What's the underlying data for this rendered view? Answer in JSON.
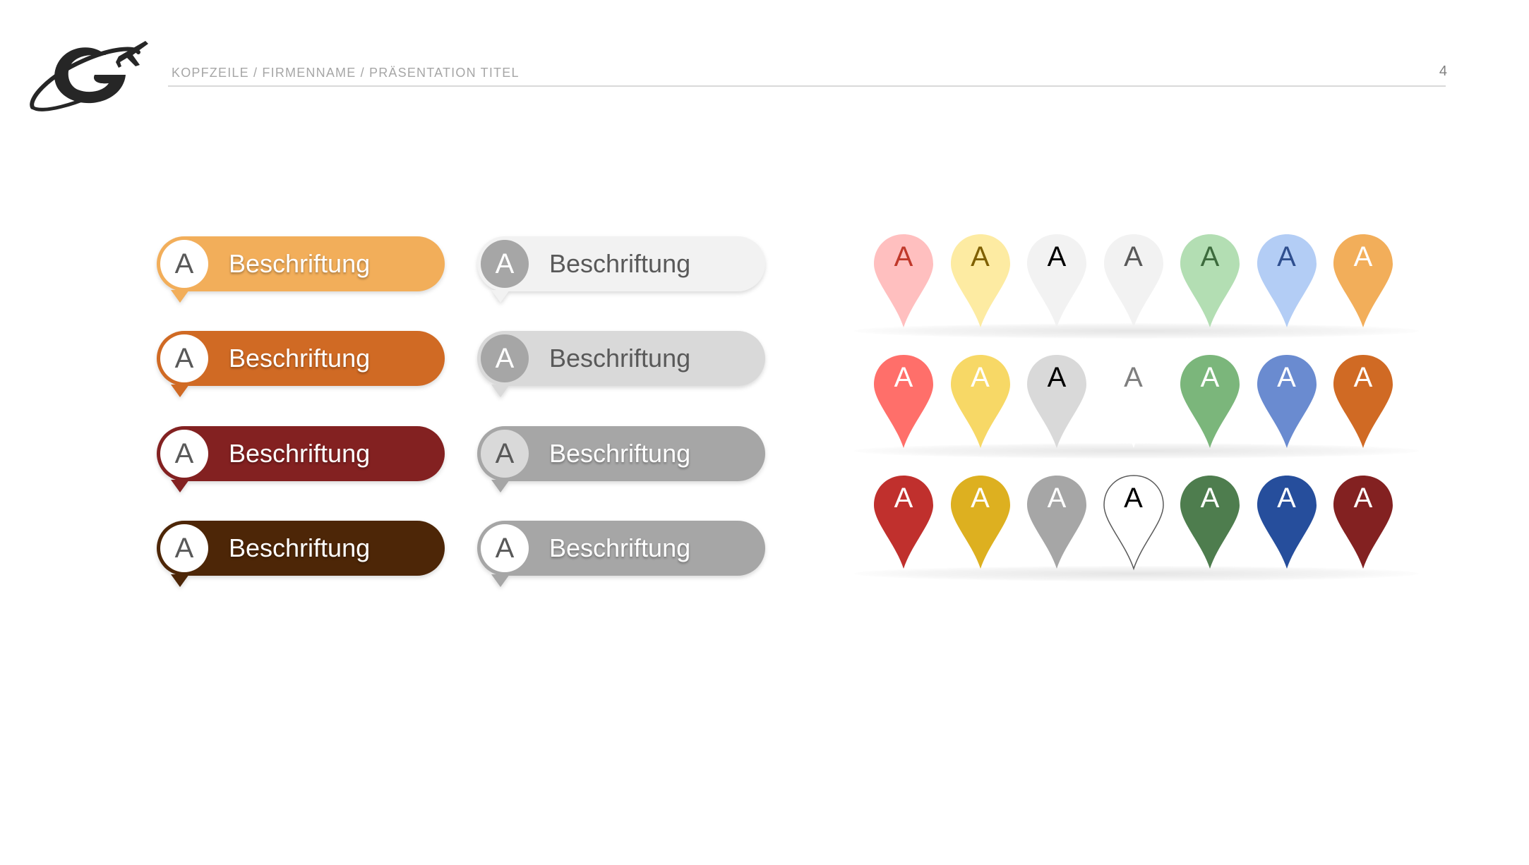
{
  "header": {
    "title": "KOPFZEILE / FIRMENNAME / PRÄSENTATION TITEL",
    "page_number": "4",
    "logo": "airplane-orbit-logo"
  },
  "labels": [
    {
      "letter": "A",
      "text": "Beschriftung",
      "bg": "#f2ae5a",
      "circle_bg": "#ffffff",
      "circle_fg": "#595959",
      "text_color": "#ffffff",
      "style": "light"
    },
    {
      "letter": "A",
      "text": "Beschriftung",
      "bg": "#d06a24",
      "circle_bg": "#ffffff",
      "circle_fg": "#595959",
      "text_color": "#ffffff",
      "style": "light"
    },
    {
      "letter": "A",
      "text": "Beschriftung",
      "bg": "#832121",
      "circle_bg": "#ffffff",
      "circle_fg": "#595959",
      "text_color": "#ffffff",
      "style": "light"
    },
    {
      "letter": "A",
      "text": "Beschriftung",
      "bg": "#4d2607",
      "circle_bg": "#ffffff",
      "circle_fg": "#595959",
      "text_color": "#ffffff",
      "style": "light"
    },
    {
      "letter": "A",
      "text": "Beschriftung",
      "bg": "#f2f2f2",
      "circle_bg": "#a6a6a6",
      "circle_fg": "#ffffff",
      "text_color": "#595959",
      "style": "dark"
    },
    {
      "letter": "A",
      "text": "Beschriftung",
      "bg": "#d9d9d9",
      "circle_bg": "#a6a6a6",
      "circle_fg": "#ffffff",
      "text_color": "#595959",
      "style": "dark"
    },
    {
      "letter": "A",
      "text": "Beschriftung",
      "bg": "#a6a6a6",
      "circle_bg": "#d9d9d9",
      "circle_fg": "#595959",
      "text_color": "#ffffff",
      "style": "light"
    },
    {
      "letter": "A",
      "text": "Beschriftung",
      "bg": "#a6a6a6",
      "circle_bg": "#ffffff",
      "circle_fg": "#595959",
      "text_color": "#ffffff",
      "style": "light"
    }
  ],
  "pins": [
    {
      "letter": "A",
      "fill": "#ffbfbf",
      "text_color": "#c0392b"
    },
    {
      "letter": "A",
      "fill": "#fdeba2",
      "text_color": "#7f6000"
    },
    {
      "letter": "A",
      "fill": "#f2f2f2",
      "text_color": "#000000"
    },
    {
      "letter": "A",
      "fill": "#f2f2f2",
      "text_color": "#595959"
    },
    {
      "letter": "A",
      "fill": "#b3deb3",
      "text_color": "#3d6b3d"
    },
    {
      "letter": "A",
      "fill": "#b3cdf5",
      "text_color": "#2f4f8f"
    },
    {
      "letter": "A",
      "fill": "#f2ae5a",
      "text_color": "#ffffff"
    },
    {
      "letter": "A",
      "fill": "#ff6f6a",
      "text_color": "#ffffff"
    },
    {
      "letter": "A",
      "fill": "#f7d866",
      "text_color": "#ffffff"
    },
    {
      "letter": "A",
      "fill": "#d9d9d9",
      "text_color": "#000000"
    },
    {
      "letter": "A",
      "fill": "#ffffff",
      "text_color": "#7f7f7f"
    },
    {
      "letter": "A",
      "fill": "#7bb67b",
      "text_color": "#ffffff"
    },
    {
      "letter": "A",
      "fill": "#6a8bd0",
      "text_color": "#ffffff"
    },
    {
      "letter": "A",
      "fill": "#d06a24",
      "text_color": "#ffffff"
    },
    {
      "letter": "A",
      "fill": "#c0302d",
      "text_color": "#ffffff"
    },
    {
      "letter": "A",
      "fill": "#ddb020",
      "text_color": "#ffffff"
    },
    {
      "letter": "A",
      "fill": "#a6a6a6",
      "text_color": "#ffffff"
    },
    {
      "letter": "A",
      "fill": "#ffffff",
      "text_color": "#000000",
      "outline": true
    },
    {
      "letter": "A",
      "fill": "#4e7d4e",
      "text_color": "#ffffff"
    },
    {
      "letter": "A",
      "fill": "#264e9c",
      "text_color": "#ffffff"
    },
    {
      "letter": "A",
      "fill": "#832121",
      "text_color": "#ffffff"
    }
  ]
}
